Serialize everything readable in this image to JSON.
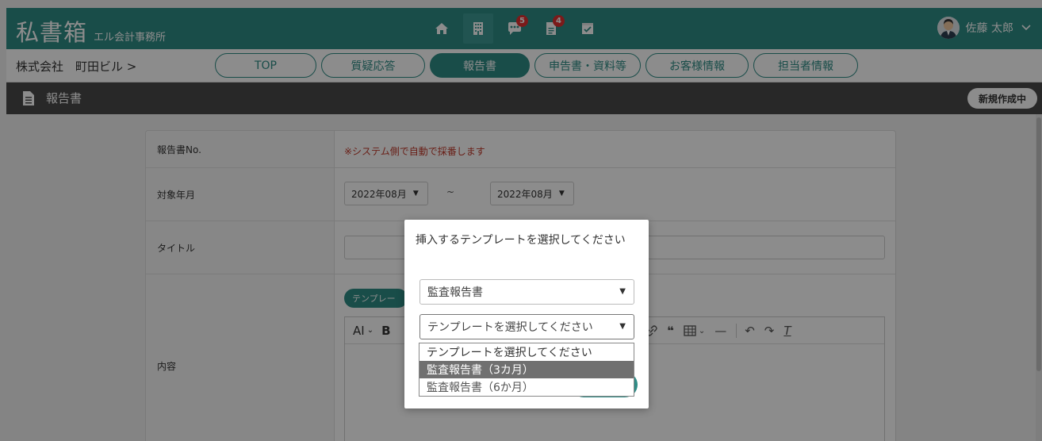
{
  "app": {
    "brand": "私書箱",
    "subtitle": "エル会計事務所",
    "badges": {
      "messages": "5",
      "reports": "4"
    },
    "user": "佐藤 太郎"
  },
  "breadcrumb": "株式会社　町田ビル >",
  "tabs": [
    {
      "label": "TOP"
    },
    {
      "label": "質疑応答"
    },
    {
      "label": "報告書"
    },
    {
      "label": "申告書・資料等"
    },
    {
      "label": "お客様情報"
    },
    {
      "label": "担当者情報"
    }
  ],
  "section": {
    "title": "報告書",
    "status": "新規作成中"
  },
  "form": {
    "report_no_label": "報告書No.",
    "report_no_note": "※システム側で自動で採番します",
    "period_label": "対象年月",
    "period_from": "2022年08月",
    "period_to": "2022年08月",
    "period_sep": "~",
    "title_label": "タイトル",
    "content_label": "内容",
    "template_pill": "テンプレー"
  },
  "modal": {
    "title": "挿入するテンプレートを選択してください",
    "category_value": "監査報告書",
    "template_placeholder": "テンプレートを選択してください",
    "options": [
      "テンプレートを選択してください",
      "監査報告書（3カ月）",
      "監査報告書（6か月）"
    ]
  },
  "colors": {
    "brand": "#2f8c86",
    "badge": "#e03030",
    "note": "#c0392b"
  }
}
